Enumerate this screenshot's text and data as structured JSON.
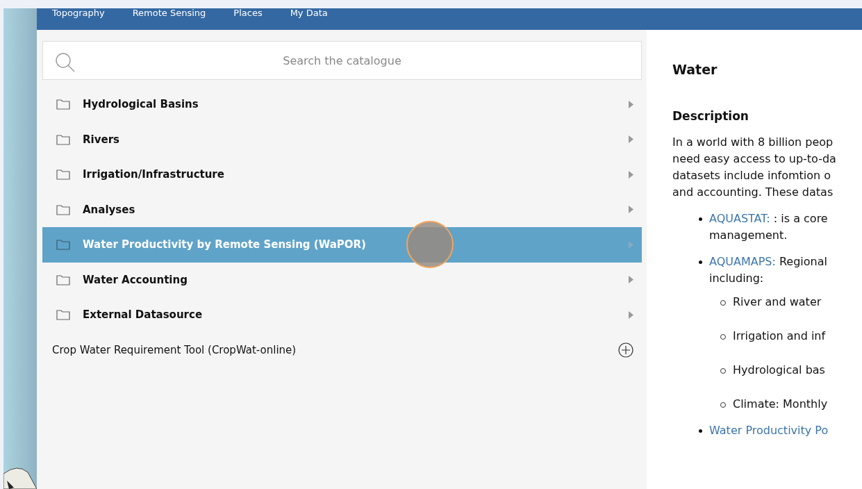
{
  "nav_tabs": [
    {
      "label": "Topography"
    },
    {
      "label": "Remote Sensing"
    },
    {
      "label": "Places"
    },
    {
      "label": "My Data"
    }
  ],
  "search": {
    "placeholder": "Search the catalogue"
  },
  "catalogue": [
    {
      "kind": "folder",
      "label": "Hydrological Basins",
      "selected": false
    },
    {
      "kind": "folder",
      "label": "Rivers",
      "selected": false
    },
    {
      "kind": "folder",
      "label": "Irrigation/Infrastructure",
      "selected": false
    },
    {
      "kind": "folder",
      "label": "Analyses",
      "selected": false
    },
    {
      "kind": "folder",
      "label": "Water Productivity by Remote Sensing (WaPOR)",
      "selected": true
    },
    {
      "kind": "folder",
      "label": "Water Accounting",
      "selected": false
    },
    {
      "kind": "folder",
      "label": "External Datasource",
      "selected": false
    },
    {
      "kind": "item",
      "label": "Crop Water Requirement Tool (CropWat-online)",
      "selected": false
    }
  ],
  "details": {
    "title": "Water",
    "section": "Description",
    "paragraph_lines": [
      "In a world with 8 billion peop",
      "need easy access to up-to-da",
      "datasets include infomtion o",
      "and accounting. These datas"
    ],
    "bullets": [
      {
        "link": "AQUASTAT:",
        "lines": [
          ": is a core",
          "management."
        ]
      },
      {
        "link": "AQUAMAPS:",
        "lines": [
          "Regional",
          "including:"
        ],
        "sub": [
          "River and water",
          "Irrigation and inf",
          "Hydrological bas",
          "Climate: Monthly"
        ]
      },
      {
        "link": "Water Productivity Po"
      }
    ]
  }
}
